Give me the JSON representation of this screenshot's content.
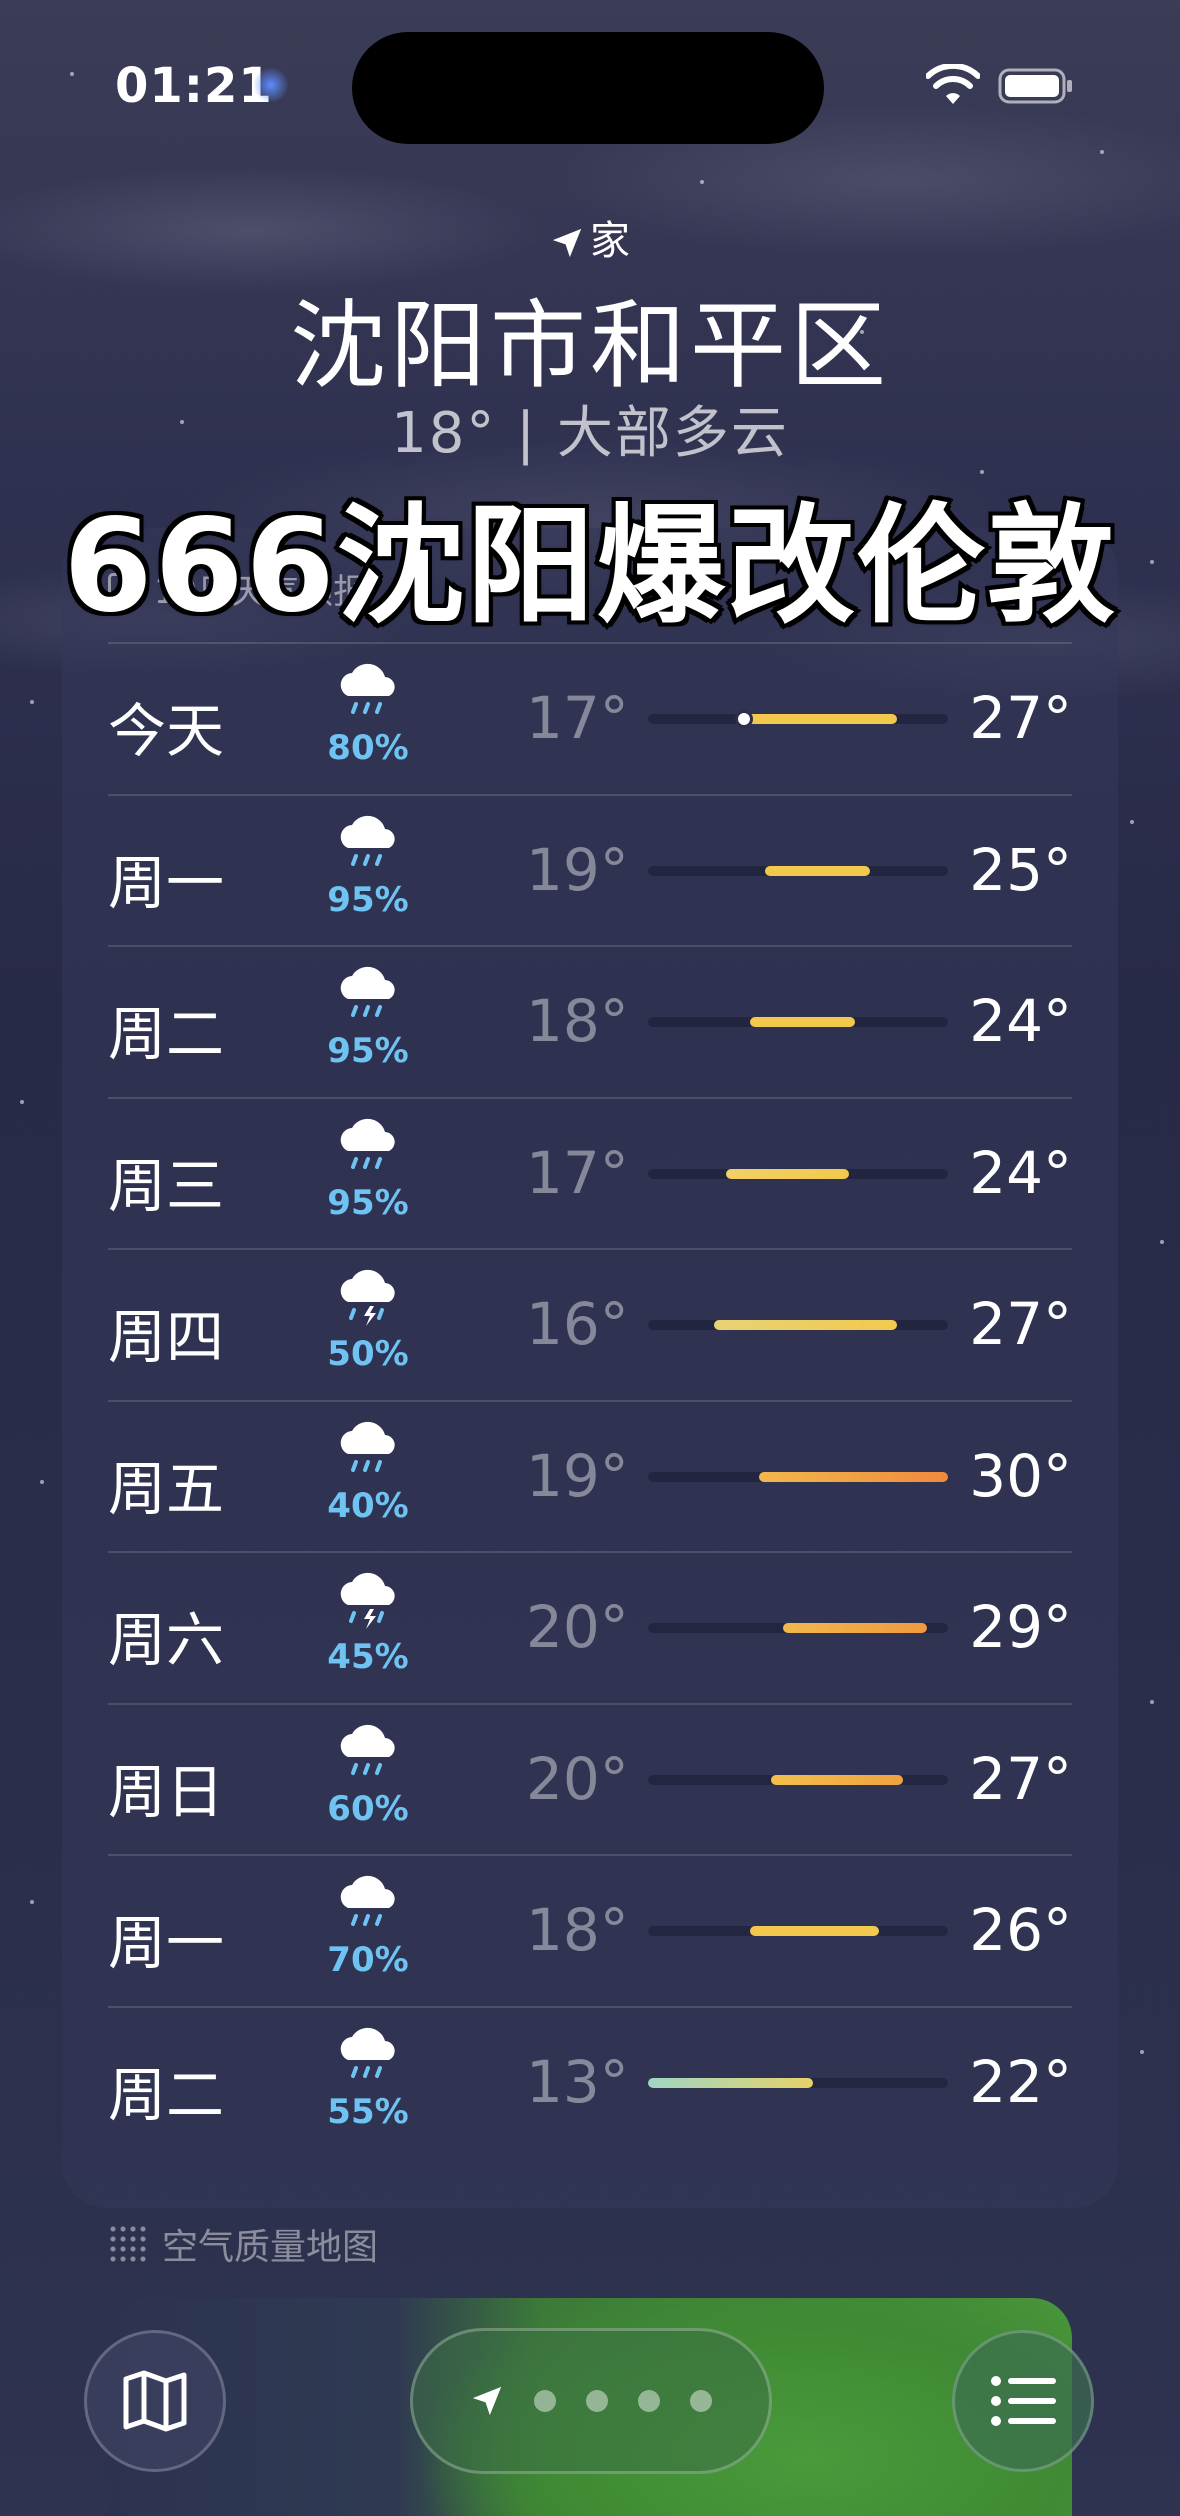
{
  "status_bar": {
    "time": "01:21"
  },
  "location": {
    "tag": "家",
    "city": "沈阳市和平区",
    "summary": "18° | 大部多云"
  },
  "overlay_caption": "666沈阳爆改伦敦",
  "forecast": {
    "header": "10日天气预报",
    "days": [
      {
        "day": "今天",
        "icon": "rain-cloud-icon",
        "precip": "80%",
        "low": "17°",
        "high": "27°",
        "bar_start": 0.3,
        "bar_end": 0.83,
        "current": 0.32,
        "color_from": "#f2c94c",
        "color_to": "#f2c94c"
      },
      {
        "day": "周一",
        "icon": "rain-cloud-icon",
        "precip": "95%",
        "low": "19°",
        "high": "25°",
        "bar_start": 0.39,
        "bar_end": 0.74,
        "color_from": "#f2c94c",
        "color_to": "#f2c94c"
      },
      {
        "day": "周二",
        "icon": "rain-cloud-icon",
        "precip": "95%",
        "low": "18°",
        "high": "24°",
        "bar_start": 0.34,
        "bar_end": 0.69,
        "color_from": "#f2c94c",
        "color_to": "#f2c94c"
      },
      {
        "day": "周三",
        "icon": "rain-cloud-icon",
        "precip": "95%",
        "low": "17°",
        "high": "24°",
        "bar_start": 0.26,
        "bar_end": 0.67,
        "color_from": "#f2d067",
        "color_to": "#f2c94c"
      },
      {
        "day": "周四",
        "icon": "thunder-cloud-icon",
        "precip": "50%",
        "low": "16°",
        "high": "27°",
        "bar_start": 0.22,
        "bar_end": 0.83,
        "color_from": "#e8d277",
        "color_to": "#f2c94c"
      },
      {
        "day": "周五",
        "icon": "rain-cloud-icon",
        "precip": "40%",
        "low": "19°",
        "high": "30°",
        "bar_start": 0.37,
        "bar_end": 1.0,
        "color_from": "#f2b84c",
        "color_to": "#ef8a3e"
      },
      {
        "day": "周六",
        "icon": "thunder-cloud-icon",
        "precip": "45%",
        "low": "20°",
        "high": "29°",
        "bar_start": 0.45,
        "bar_end": 0.93,
        "color_from": "#f2b84c",
        "color_to": "#ef9a3e"
      },
      {
        "day": "周日",
        "icon": "rain-cloud-icon",
        "precip": "60%",
        "low": "20°",
        "high": "27°",
        "bar_start": 0.41,
        "bar_end": 0.85,
        "color_from": "#f2c04c",
        "color_to": "#f0a240"
      },
      {
        "day": "周一",
        "icon": "rain-cloud-icon",
        "precip": "70%",
        "low": "18°",
        "high": "26°",
        "bar_start": 0.34,
        "bar_end": 0.77,
        "color_from": "#f2c94c",
        "color_to": "#f2c94c"
      },
      {
        "day": "周二",
        "icon": "rain-cloud-icon",
        "precip": "55%",
        "low": "13°",
        "high": "22°",
        "bar_start": 0.0,
        "bar_end": 0.55,
        "color_from": "#9fd6c4",
        "color_to": "#e6d26a"
      }
    ]
  },
  "air_quality": {
    "label": "空气质量地图"
  },
  "toolbar": {
    "map_icon": "map-icon",
    "list_icon": "list-icon",
    "page_dots": 4
  },
  "colors": {
    "precip": "#6ec3f2",
    "bar_yellow": "#f2c94c",
    "bar_orange": "#ef8a3e"
  }
}
